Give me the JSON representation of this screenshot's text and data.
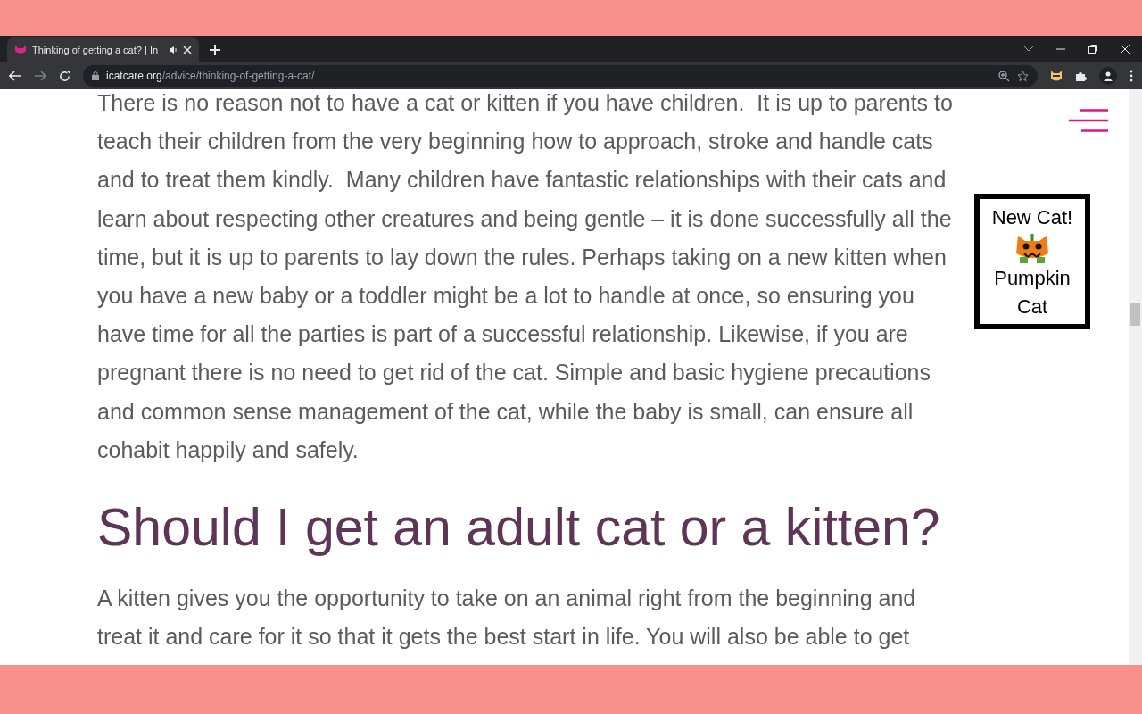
{
  "browser": {
    "tab": {
      "title": "Thinking of getting a cat? | In",
      "selected": true
    },
    "address": {
      "domain": "icatcare.org",
      "path": "/advice/thinking-of-getting-a-cat/"
    }
  },
  "article": [
    {
      "kind": "paragraph",
      "lines": [
        "There is no reason not to have a cat or kitten if you have children.  It is up to parents to",
        "teach their children from the very beginning how to approach, stroke and handle cats",
        "and to treat them kindly.  Many children have fantastic relationships with their cats and",
        "learn about respecting other creatures and being gentle – it is done successfully all the",
        "time, but it is up to parents to lay down the rules. Perhaps taking on a new kitten when",
        "you have a new baby or a toddler might be a lot to handle at once, so ensuring you",
        "have time for all the parties is part of a successful relationship. Likewise, if you are",
        "pregnant there is no need to get rid of the cat. Simple and basic hygiene precautions",
        "and common sense management of the cat, while the baby is small, can ensure all",
        "cohabit happily and safely."
      ]
    },
    {
      "kind": "heading",
      "lines": [
        "Should I get an adult cat or a kitten?"
      ]
    },
    {
      "kind": "paragraph",
      "lines": [
        "A kitten gives you the opportunity to take on an animal right from the beginning and",
        "treat it and care for it so that it gets the best start in life. You will also be able to get"
      ]
    }
  ],
  "popup": {
    "title": "New Cat!",
    "name": "Pumpkin Cat"
  }
}
